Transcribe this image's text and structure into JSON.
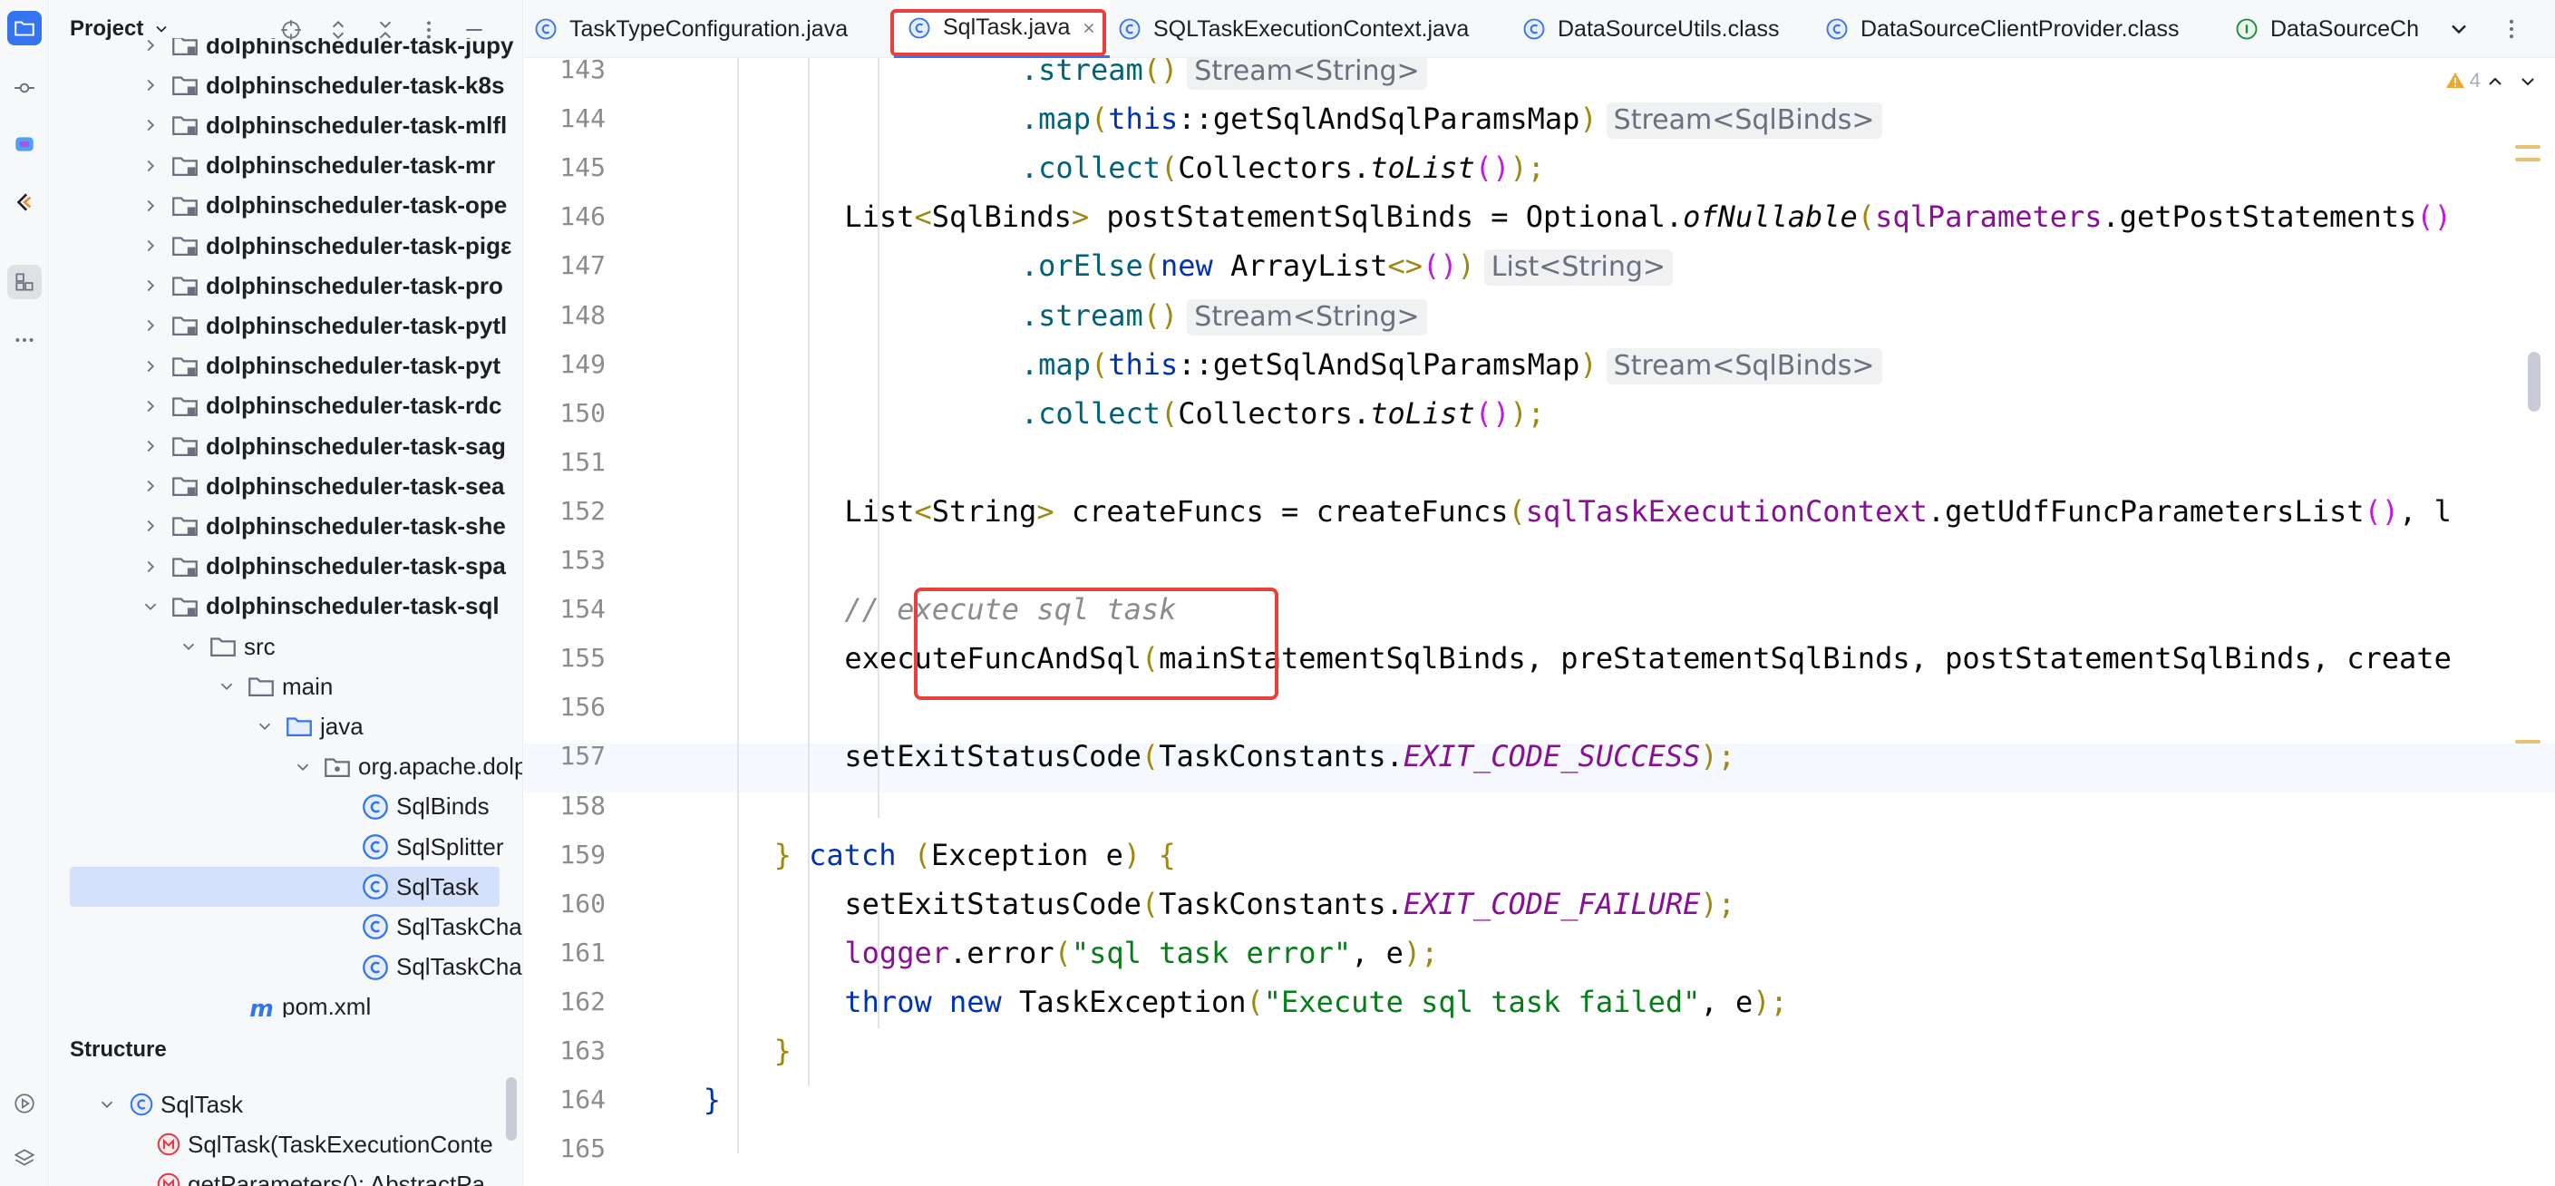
{
  "project_panel": {
    "title": "Project",
    "tree": [
      {
        "label": "dolphinscheduler-task-jupy",
        "bold": true,
        "expanded": false,
        "indent": 0,
        "icon": "module-folder-icon"
      },
      {
        "label": "dolphinscheduler-task-k8s",
        "bold": true,
        "expanded": false,
        "indent": 0,
        "icon": "module-folder-icon"
      },
      {
        "label": "dolphinscheduler-task-mlfl",
        "bold": true,
        "expanded": false,
        "indent": 0,
        "icon": "module-folder-icon"
      },
      {
        "label": "dolphinscheduler-task-mr",
        "bold": true,
        "expanded": false,
        "indent": 0,
        "icon": "module-folder-icon"
      },
      {
        "label": "dolphinscheduler-task-ope",
        "bold": true,
        "expanded": false,
        "indent": 0,
        "icon": "module-folder-icon"
      },
      {
        "label": "dolphinscheduler-task-pigε",
        "bold": true,
        "expanded": false,
        "indent": 0,
        "icon": "module-folder-icon"
      },
      {
        "label": "dolphinscheduler-task-pro",
        "bold": true,
        "expanded": false,
        "indent": 0,
        "icon": "module-folder-icon"
      },
      {
        "label": "dolphinscheduler-task-pytl",
        "bold": true,
        "expanded": false,
        "indent": 0,
        "icon": "module-folder-icon"
      },
      {
        "label": "dolphinscheduler-task-pyt",
        "bold": true,
        "expanded": false,
        "indent": 0,
        "icon": "module-folder-icon"
      },
      {
        "label": "dolphinscheduler-task-rdc",
        "bold": true,
        "expanded": false,
        "indent": 0,
        "icon": "module-folder-icon"
      },
      {
        "label": "dolphinscheduler-task-sag",
        "bold": true,
        "expanded": false,
        "indent": 0,
        "icon": "module-folder-icon"
      },
      {
        "label": "dolphinscheduler-task-sea",
        "bold": true,
        "expanded": false,
        "indent": 0,
        "icon": "module-folder-icon"
      },
      {
        "label": "dolphinscheduler-task-she",
        "bold": true,
        "expanded": false,
        "indent": 0,
        "icon": "module-folder-icon"
      },
      {
        "label": "dolphinscheduler-task-spa",
        "bold": true,
        "expanded": false,
        "indent": 0,
        "icon": "module-folder-icon"
      },
      {
        "label": "dolphinscheduler-task-sql",
        "bold": true,
        "expanded": true,
        "indent": 0,
        "icon": "module-folder-icon"
      },
      {
        "label": "src",
        "bold": false,
        "expanded": true,
        "indent": 1,
        "icon": "folder-icon"
      },
      {
        "label": "main",
        "bold": false,
        "expanded": true,
        "indent": 2,
        "icon": "folder-icon"
      },
      {
        "label": "java",
        "bold": false,
        "expanded": true,
        "indent": 3,
        "icon": "source-folder-icon"
      },
      {
        "label": "org.apache.dolp",
        "bold": false,
        "expanded": true,
        "indent": 4,
        "icon": "package-icon"
      },
      {
        "label": "SqlBinds",
        "bold": false,
        "expanded": null,
        "indent": 5,
        "icon": "class-icon"
      },
      {
        "label": "SqlSplitter",
        "bold": false,
        "expanded": null,
        "indent": 5,
        "icon": "class-icon"
      },
      {
        "label": "SqlTask",
        "bold": false,
        "expanded": null,
        "indent": 5,
        "icon": "class-icon",
        "selected": true
      },
      {
        "label": "SqlTaskChar",
        "bold": false,
        "expanded": null,
        "indent": 5,
        "icon": "class-icon"
      },
      {
        "label": "SqlTaskChar",
        "bold": false,
        "expanded": null,
        "indent": 5,
        "icon": "class-icon"
      },
      {
        "label": "pom.xml",
        "bold": false,
        "expanded": null,
        "indent": 2,
        "icon": "maven-icon"
      }
    ]
  },
  "structure_panel": {
    "title": "Structure",
    "items": [
      {
        "label": "SqlTask",
        "icon": "class-icon",
        "expanded": true
      },
      {
        "label": "SqlTask(TaskExecutionConte",
        "icon": "method-icon"
      },
      {
        "label": "getParameters(): AbstractPa",
        "icon": "method-icon"
      }
    ]
  },
  "tabs": [
    {
      "label": "TaskTypeConfiguration.java",
      "icon": "class-icon",
      "active": false
    },
    {
      "label": "SqlTask.java",
      "icon": "class-icon",
      "active": true
    },
    {
      "label": "SQLTaskExecutionContext.java",
      "icon": "class-icon",
      "active": false
    },
    {
      "label": "DataSourceUtils.class",
      "icon": "class-icon",
      "active": false
    },
    {
      "label": "DataSourceClientProvider.class",
      "icon": "class-icon",
      "active": false
    },
    {
      "label": "DataSourceCh",
      "icon": "interface-icon",
      "active": false
    }
  ],
  "editor": {
    "warning_count": "4",
    "lines": [
      {
        "n": "143",
        "indent": 11,
        "tokens": [
          [
            ".stream",
            "fn"
          ],
          [
            "()",
            "br-y"
          ]
        ],
        "hint": "Stream<String>"
      },
      {
        "n": "144",
        "indent": 11,
        "tokens": [
          [
            ".map",
            "fn"
          ],
          [
            "(",
            "br-y"
          ],
          [
            "this",
            "kw"
          ],
          [
            "::getSqlAndSqlParamsMap",
            ""
          ],
          [
            ")",
            "br-y"
          ]
        ],
        "hint": "Stream<SqlBinds>"
      },
      {
        "n": "145",
        "indent": 11,
        "tokens": [
          [
            ".collect",
            "fn"
          ],
          [
            "(",
            "br-y"
          ],
          [
            "Collectors.",
            ""
          ],
          [
            "toList",
            "it"
          ],
          [
            "()",
            "br-p"
          ],
          [
            ");",
            "br-y"
          ]
        ]
      },
      {
        "n": "146",
        "indent": 6,
        "tokens": [
          [
            "List",
            ""
          ],
          [
            "<",
            "br-y"
          ],
          [
            "SqlBinds",
            ""
          ],
          [
            ">",
            "br-y"
          ],
          [
            " postStatementSqlBinds = Optional.",
            ""
          ],
          [
            "ofNullable",
            "it"
          ],
          [
            "(",
            "br-y"
          ],
          [
            "sqlParameters",
            "fld"
          ],
          [
            ".getPostStatements",
            ""
          ],
          [
            "()",
            "br-p"
          ]
        ]
      },
      {
        "n": "147",
        "indent": 11,
        "tokens": [
          [
            ".orElse",
            "fn"
          ],
          [
            "(",
            "br-y"
          ],
          [
            "new ",
            "kw"
          ],
          [
            "ArrayList",
            ""
          ],
          [
            "<>",
            "br-y"
          ],
          [
            "()",
            "br-p"
          ],
          [
            ")",
            "br-y"
          ]
        ],
        "hint": "List<String>"
      },
      {
        "n": "148",
        "indent": 11,
        "tokens": [
          [
            ".stream",
            "fn"
          ],
          [
            "()",
            "br-y"
          ]
        ],
        "hint": "Stream<String>"
      },
      {
        "n": "149",
        "indent": 11,
        "tokens": [
          [
            ".map",
            "fn"
          ],
          [
            "(",
            "br-y"
          ],
          [
            "this",
            "kw"
          ],
          [
            "::getSqlAndSqlParamsMap",
            ""
          ],
          [
            ")",
            "br-y"
          ]
        ],
        "hint": "Stream<SqlBinds>"
      },
      {
        "n": "150",
        "indent": 11,
        "tokens": [
          [
            ".collect",
            "fn"
          ],
          [
            "(",
            "br-y"
          ],
          [
            "Collectors.",
            ""
          ],
          [
            "toList",
            "it"
          ],
          [
            "()",
            "br-p"
          ],
          [
            ");",
            "br-y"
          ]
        ]
      },
      {
        "n": "151",
        "indent": 0,
        "tokens": []
      },
      {
        "n": "152",
        "indent": 6,
        "tokens": [
          [
            "List",
            ""
          ],
          [
            "<",
            "br-y"
          ],
          [
            "String",
            ""
          ],
          [
            ">",
            "br-y"
          ],
          [
            " createFuncs = createFuncs",
            ""
          ],
          [
            "(",
            "br-y"
          ],
          [
            "sqlTaskExecutionContext",
            "fld"
          ],
          [
            ".getUdfFuncParametersList",
            ""
          ],
          [
            "()",
            "br-p"
          ],
          [
            ", l",
            ""
          ]
        ]
      },
      {
        "n": "153",
        "indent": 0,
        "tokens": []
      },
      {
        "n": "154",
        "indent": 6,
        "tokens": [
          [
            "// execute sql task",
            "cmt"
          ]
        ]
      },
      {
        "n": "155",
        "indent": 6,
        "tokens": [
          [
            "executeFuncAndSql",
            ""
          ],
          [
            "(",
            "br-y"
          ],
          [
            "mainStatementSqlBinds, preStatementSqlBinds, postStatementSqlBinds, create",
            ""
          ]
        ]
      },
      {
        "n": "156",
        "indent": 0,
        "tokens": []
      },
      {
        "n": "157",
        "indent": 6,
        "tokens": [
          [
            "setExitStatusCode",
            ""
          ],
          [
            "(",
            "br-y"
          ],
          [
            "TaskConstants.",
            ""
          ],
          [
            "EXIT_CODE_SUCCESS",
            "stat"
          ],
          [
            ");",
            "br-y"
          ]
        ]
      },
      {
        "n": "158",
        "indent": 0,
        "tokens": []
      },
      {
        "n": "159",
        "indent": 4,
        "tokens": [
          [
            "} ",
            "br-y"
          ],
          [
            "catch ",
            "kw"
          ],
          [
            "(",
            "br-y"
          ],
          [
            "Exception e",
            ""
          ],
          [
            ") {",
            "br-y"
          ]
        ]
      },
      {
        "n": "160",
        "indent": 6,
        "tokens": [
          [
            "setExitStatusCode",
            ""
          ],
          [
            "(",
            "br-y"
          ],
          [
            "TaskConstants.",
            ""
          ],
          [
            "EXIT_CODE_FAILURE",
            "stat"
          ],
          [
            ");",
            "br-y"
          ]
        ]
      },
      {
        "n": "161",
        "indent": 6,
        "tokens": [
          [
            "logger",
            "fld"
          ],
          [
            ".error",
            ""
          ],
          [
            "(",
            "br-y"
          ],
          [
            "\"sql task error\"",
            "str"
          ],
          [
            ", e",
            ""
          ],
          [
            ");",
            "br-y"
          ]
        ]
      },
      {
        "n": "162",
        "indent": 6,
        "tokens": [
          [
            "throw ",
            "kw"
          ],
          [
            "new ",
            "kw"
          ],
          [
            "TaskException",
            ""
          ],
          [
            "(",
            "br-y"
          ],
          [
            "\"Execute sql task failed\"",
            "str"
          ],
          [
            ", e",
            ""
          ],
          [
            ");",
            "br-y"
          ]
        ]
      },
      {
        "n": "163",
        "indent": 4,
        "tokens": [
          [
            "}",
            "br-y"
          ]
        ]
      },
      {
        "n": "164",
        "indent": 2,
        "tokens": [
          [
            "}",
            "br-b"
          ]
        ]
      },
      {
        "n": "165",
        "indent": 0,
        "tokens": []
      }
    ]
  },
  "colors": {
    "accent": "#3574f0",
    "highlight_box": "#e8403a",
    "keyword": "#0033b3",
    "string": "#067d17",
    "field": "#871094",
    "comment": "#8c8c8c"
  }
}
